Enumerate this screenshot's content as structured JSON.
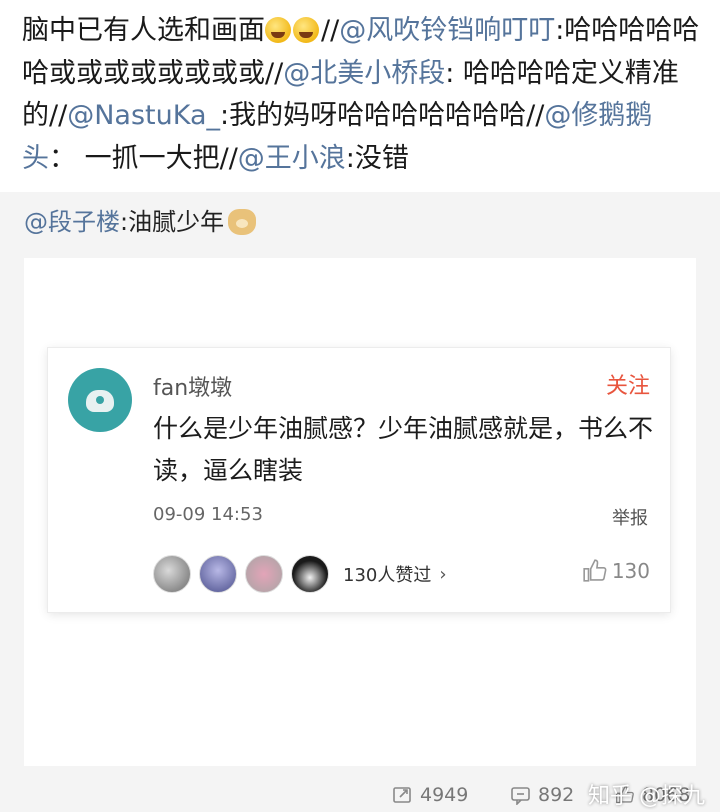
{
  "post": {
    "line1": "脑中已有人选和画面",
    "line1b": "//",
    "m1": "@风吹铃铛响叮叮",
    "t1": ":哈哈哈哈哈哈或或或或或或或或",
    "line2b": "//",
    "m2": "@北美小桥段",
    "t2": ": 哈哈哈哈定义精准的",
    "line3b": "//",
    "m3": "@NastuKa_",
    "t3": ":我的妈呀哈哈哈哈哈哈哈",
    "line4b": "//",
    "m4": "@修鹅鹅头",
    "t4": "： 一抓一大把",
    "line5b": "//",
    "m5": "@王小浪",
    "t5": ":没错"
  },
  "repost": {
    "mention": "@段子楼",
    "text": ":油腻少年"
  },
  "card": {
    "username": "fan墩墩",
    "follow": "关注",
    "content": "什么是少年油腻感？少年油腻感就是，书么不读，逼么瞎装",
    "timestamp": "09-09 14:53",
    "report": "举报",
    "liked_text": "130人赞过",
    "chevron": "›",
    "like_count": "130"
  },
  "stats": {
    "reposts": "4949",
    "comments": "892",
    "likes": "8068"
  },
  "watermark": {
    "zhihu": "知乎 @探九"
  },
  "colors": {
    "mention": "#55749b",
    "follow": "#e8553e",
    "repost_bg": "#f4f4f4"
  }
}
